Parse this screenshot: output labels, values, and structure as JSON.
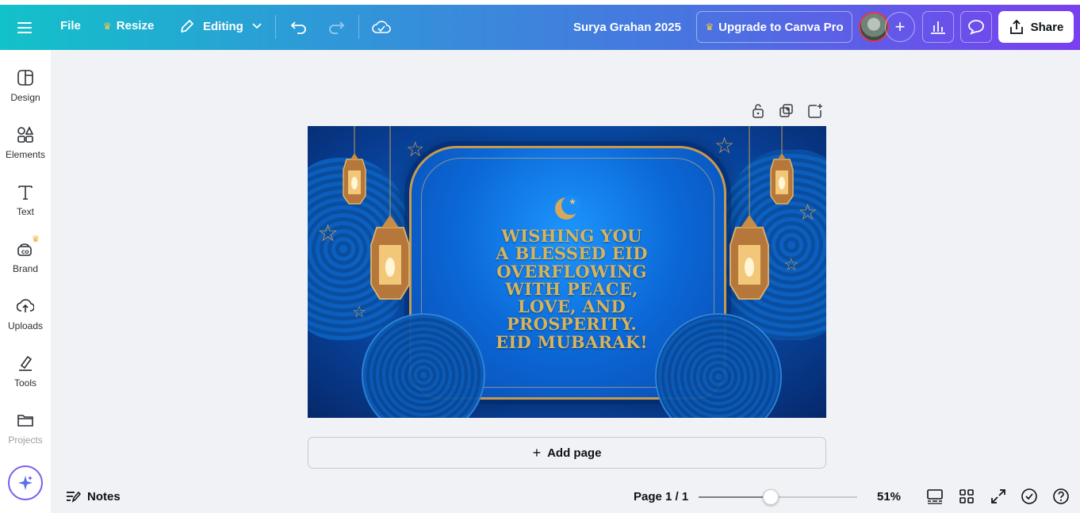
{
  "topbar": {
    "file_label": "File",
    "resize_label": "Resize",
    "mode_label": "Editing",
    "design_title": "Surya Grahan 2025",
    "upgrade_label": "Upgrade to Canva Pro",
    "share_label": "Share"
  },
  "sidebar": {
    "items": [
      {
        "label": "Design",
        "icon": "design-icon"
      },
      {
        "label": "Elements",
        "icon": "elements-icon"
      },
      {
        "label": "Text",
        "icon": "text-icon"
      },
      {
        "label": "Brand",
        "icon": "brand-icon"
      },
      {
        "label": "Uploads",
        "icon": "uploads-icon"
      },
      {
        "label": "Tools",
        "icon": "tools-icon"
      },
      {
        "label": "Projects",
        "icon": "projects-icon"
      }
    ]
  },
  "canvas": {
    "text_lines": [
      "WISHING YOU",
      "A BLESSED EID",
      "OVERFLOWING",
      "WITH PEACE,",
      "LOVE, AND",
      "PROSPERITY.",
      "EID MUBARAK!"
    ]
  },
  "add_page_label": "Add page",
  "bottombar": {
    "notes_label": "Notes",
    "page_indicator": "Page 1 / 1",
    "zoom_label": "51%",
    "zoom_value": 51
  },
  "colors": {
    "gradient_start": "#12c2c9",
    "gradient_end": "#7a3ff0",
    "text_gold": "#d7b35c",
    "brand_crown": "#f5a623"
  }
}
